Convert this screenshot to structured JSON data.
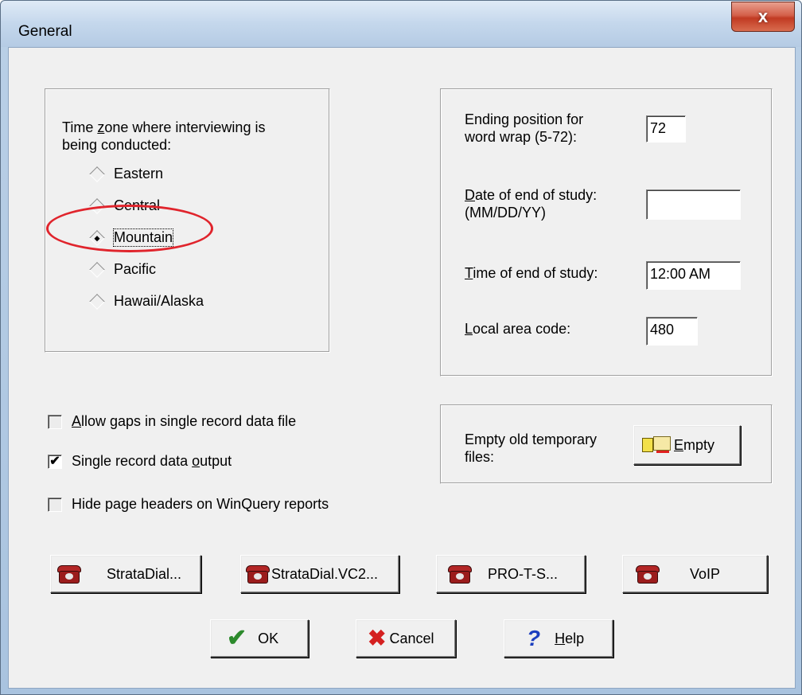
{
  "window": {
    "title": "General",
    "close_glyph": "x"
  },
  "timezone": {
    "label_line1_pre": "Time ",
    "label_line1_acc": "z",
    "label_line1_post": "one where interviewing is",
    "label_line2": "being conducted:",
    "options": [
      {
        "label": "Eastern",
        "selected": false
      },
      {
        "label": "Central",
        "selected": false
      },
      {
        "label": "Mountain",
        "selected": true
      },
      {
        "label": "Pacific",
        "selected": false
      },
      {
        "label": "Hawaii/Alaska",
        "selected": false
      }
    ]
  },
  "settings": {
    "word_wrap_label_1": "Ending position for",
    "word_wrap_label_2": "word wrap (5-72):",
    "word_wrap_value": "72",
    "end_date_label_acc": "D",
    "end_date_label_1": "ate of end of study:",
    "end_date_label_2": "(MM/DD/YY)",
    "end_date_value": "",
    "end_time_label_acc": "T",
    "end_time_label": "ime of end of study:",
    "end_time_value": "12:00 AM",
    "area_code_label_acc": "L",
    "area_code_label": "ocal area code:",
    "area_code_value": "480"
  },
  "temp_files": {
    "label_1": "Empty old temporary",
    "label_2": "files:",
    "button_acc": "E",
    "button_label": "mpty"
  },
  "checkboxes": [
    {
      "acc": "A",
      "label": "llow gaps in single record data file",
      "checked": false
    },
    {
      "pre": "Single record data ",
      "acc": "o",
      "label": "utput",
      "checked": true
    },
    {
      "label": "Hide page headers on WinQuery reports",
      "checked": false
    }
  ],
  "dialer_buttons": [
    {
      "label": "StrataDial...",
      "icon": "phone-icon"
    },
    {
      "label": "StrataDial.VC2...",
      "icon": "phone-icon"
    },
    {
      "label": "PRO-T-S...",
      "icon": "phone-icon"
    },
    {
      "label": "VoIP",
      "icon": "phone-icon"
    }
  ],
  "actions": {
    "ok_label": "OK",
    "cancel_label": "Cancel",
    "help_acc": "H",
    "help_label": "elp"
  },
  "colors": {
    "highlight_ellipse": "#e0242c",
    "ok_check": "#2c8a2c",
    "cancel_x": "#d42020",
    "help_q": "#1c3fbf"
  }
}
